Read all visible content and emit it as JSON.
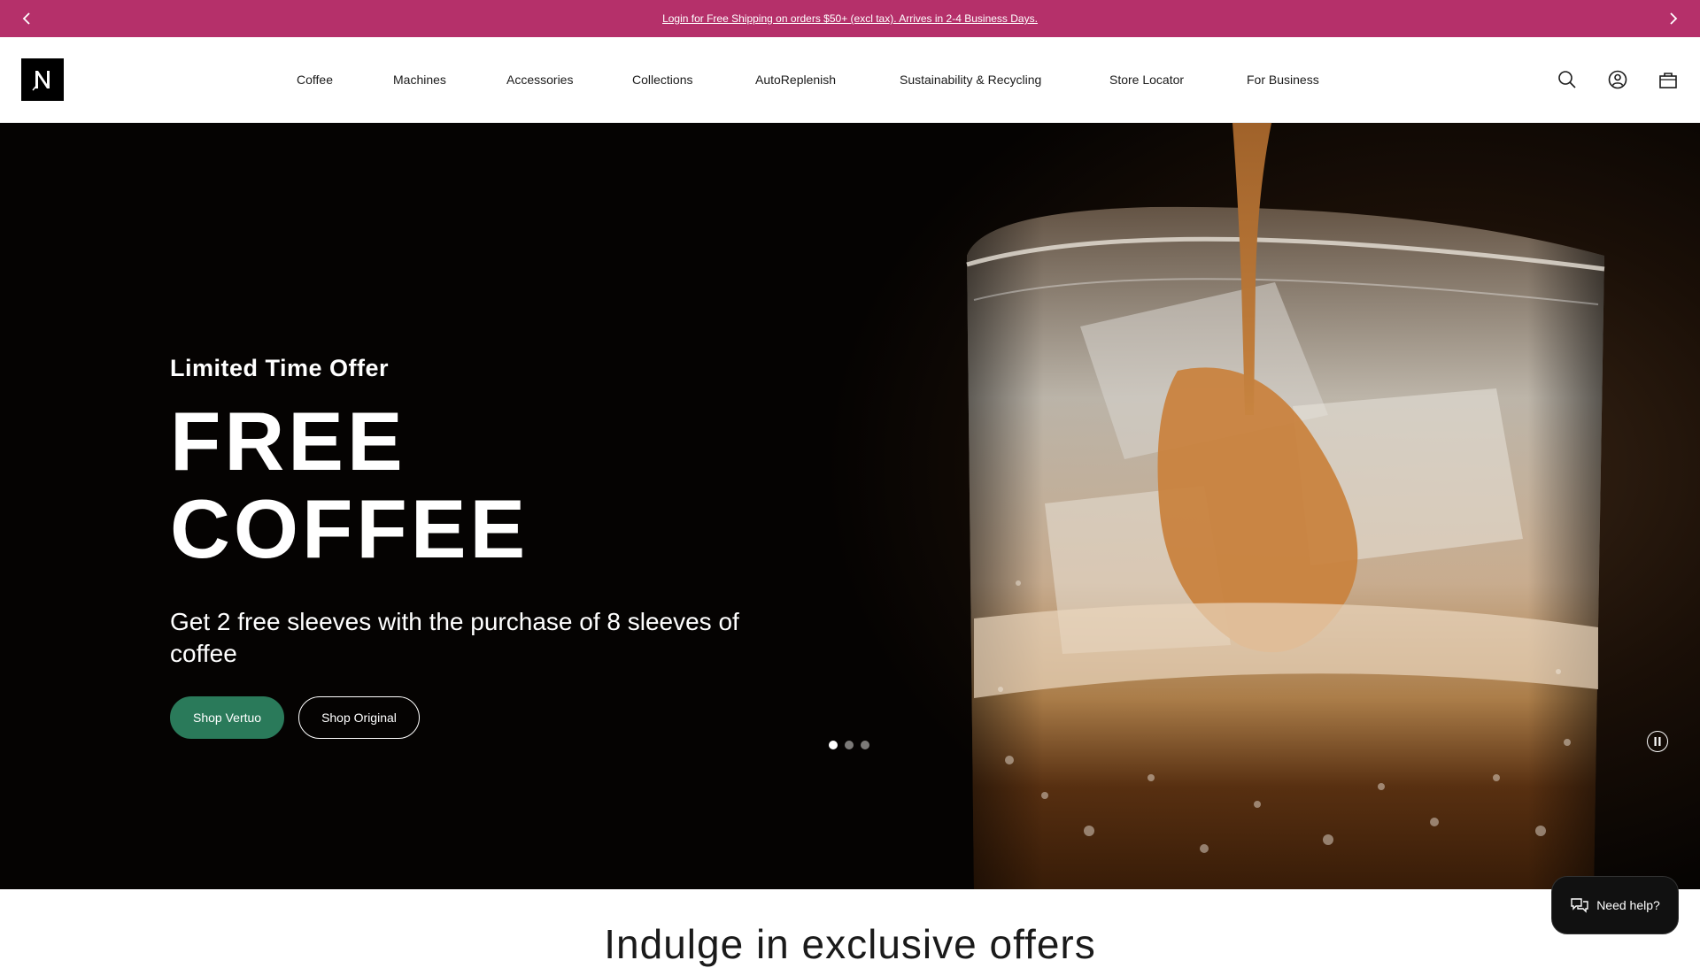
{
  "promo": {
    "text": "Login for Free Shipping on orders $50+ (excl tax). Arrives in 2-4 Business Days.",
    "prev_icon": "chevron-left-icon",
    "next_icon": "chevron-right-icon"
  },
  "header": {
    "logo_icon": "nespresso-logo-icon",
    "nav": [
      "Coffee",
      "Machines",
      "Accessories",
      "Collections",
      "AutoReplenish",
      "Sustainability & Recycling",
      "Store Locator",
      "For Business"
    ],
    "icons": [
      "search-icon",
      "account-icon",
      "bag-icon"
    ]
  },
  "hero": {
    "eyebrow": "Limited Time Offer",
    "headline": "FREE COFFEE",
    "subline": "Get 2 free sleeves with the purchase of 8 sleeves of coffee",
    "primary_cta": "Shop Vertuo",
    "secondary_cta": "Shop Original",
    "slides_total": 3,
    "active_slide": 1,
    "colors": {
      "primary_cta": "#2a7a5a",
      "promo_bar": "#b5306a"
    }
  },
  "section": {
    "title": "Indulge in exclusive offers"
  },
  "chat": {
    "label": "Need help?",
    "icon": "chat-bubbles-icon"
  }
}
